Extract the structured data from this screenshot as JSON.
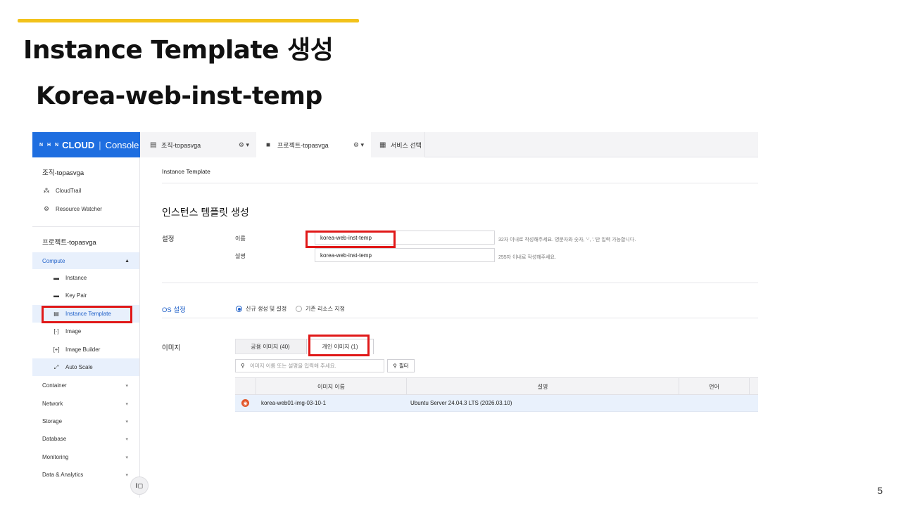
{
  "slide": {
    "title": "Instance Template 생성",
    "subtitle": "Korea-web-inst-temp",
    "page_number": "5",
    "accent_color": "#f2c21b",
    "highlight_color": "#e01818"
  },
  "topbar": {
    "logo_nhn": "N H N",
    "logo_cloud": "CLOUD",
    "logo_sep": "|",
    "logo_console": "Console",
    "org_label": "조직-topasvga",
    "project_label": "프로젝트-topasvga",
    "service_label": "서비스 선택",
    "settings_glyph": "⚙ ▾",
    "brand_color": "#1e6ee0"
  },
  "sidebar": {
    "org_name": "조직-topasvga",
    "org_items": [
      {
        "label": "CloudTrail",
        "icon": "cloudtrail-icon"
      },
      {
        "label": "Resource Watcher",
        "icon": "resource-watcher-icon"
      }
    ],
    "project_name": "프로젝트-topasvga",
    "compute": {
      "label": "Compute",
      "items": [
        {
          "label": "Instance",
          "icon": "instance-icon"
        },
        {
          "label": "Key Pair",
          "icon": "key-pair-icon"
        },
        {
          "label": "Instance Template",
          "icon": "instance-template-icon"
        },
        {
          "label": "Image",
          "icon": "image-icon"
        },
        {
          "label": "Image Builder",
          "icon": "image-builder-icon"
        },
        {
          "label": "Auto Scale",
          "icon": "auto-scale-icon"
        }
      ]
    },
    "categories": [
      "Container",
      "Network",
      "Storage",
      "Database",
      "Monitoring",
      "Data & Analytics"
    ],
    "collapse_label": "I◻"
  },
  "main": {
    "breadcrumb": "Instance Template",
    "page_title": "인스턴스 템플릿 생성",
    "settings": {
      "section_label": "설정",
      "name_label": "이름",
      "name_value": "korea-web-inst-temp",
      "name_help": "32자 이내로 작성해주세요. 영문자와 숫자, '-', '.'만 입력 가능합니다.",
      "desc_label": "설명",
      "desc_value": "korea-web-inst-temp",
      "desc_help": "255자 이내로 작성해주세요."
    },
    "os": {
      "section_label": "OS 설정",
      "option_new": "신규 생성 및 설정",
      "option_existing": "기존 리소스 지정",
      "selected": "신규 생성 및 설정"
    },
    "image": {
      "section_label": "이미지",
      "tab_public": "공용 이미지 (40)",
      "tab_private": "개인 이미지 (1)",
      "active_tab": "개인 이미지 (1)",
      "search_placeholder": "이미지 이름 또는 설명을 입력해 주세요.",
      "filter_label": "필터",
      "columns": [
        "이미지 이름",
        "설명",
        "언어"
      ],
      "rows": [
        {
          "os_icon": "ubuntu-icon",
          "name": "korea-web01-img-03-10-1",
          "description": "Ubuntu Server 24.04.3 LTS (2026.03.10)",
          "language": ""
        }
      ]
    }
  }
}
